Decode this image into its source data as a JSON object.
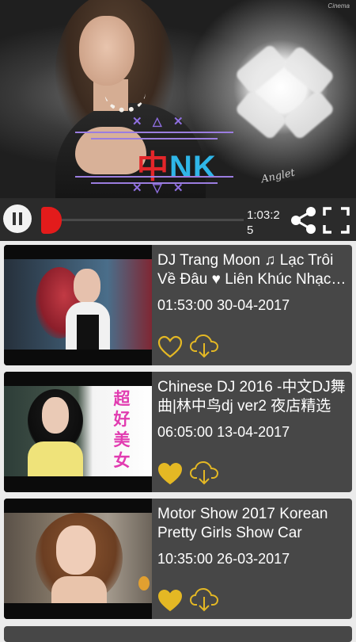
{
  "player": {
    "logo_zh": "中",
    "logo_en": "NK",
    "signature": "Anglet",
    "watermark": "Cinema",
    "time": "1:03:25",
    "progress": 0.02,
    "controls": {
      "play_state": "pause-icon",
      "share_icon": "share-icon",
      "fullscreen_icon": "fullscreen-icon"
    }
  },
  "videos": [
    {
      "title": "DJ Trang Moon ♫ Lạc Trôi Về Đâu ♥ Liên Khúc Nhạc Trẻ",
      "meta": "01:53:00 30-04-2017",
      "favorite": false
    },
    {
      "title": "Chinese DJ 2016 -中文DJ舞曲|林中鸟dj ver2 夜店精选",
      "meta": "06:05:00 13-04-2017",
      "favorite": true,
      "thumb_caption": "超好美女"
    },
    {
      "title": "Motor Show 2017 Korean Pretty Girls Show Car",
      "meta": "10:35:00 26-03-2017",
      "favorite": true
    }
  ],
  "colors": {
    "accent_gold": "#e4b824",
    "seek_red": "#e31b1b",
    "bar_bg": "#2b2b2b",
    "card_bg": "#474747"
  }
}
